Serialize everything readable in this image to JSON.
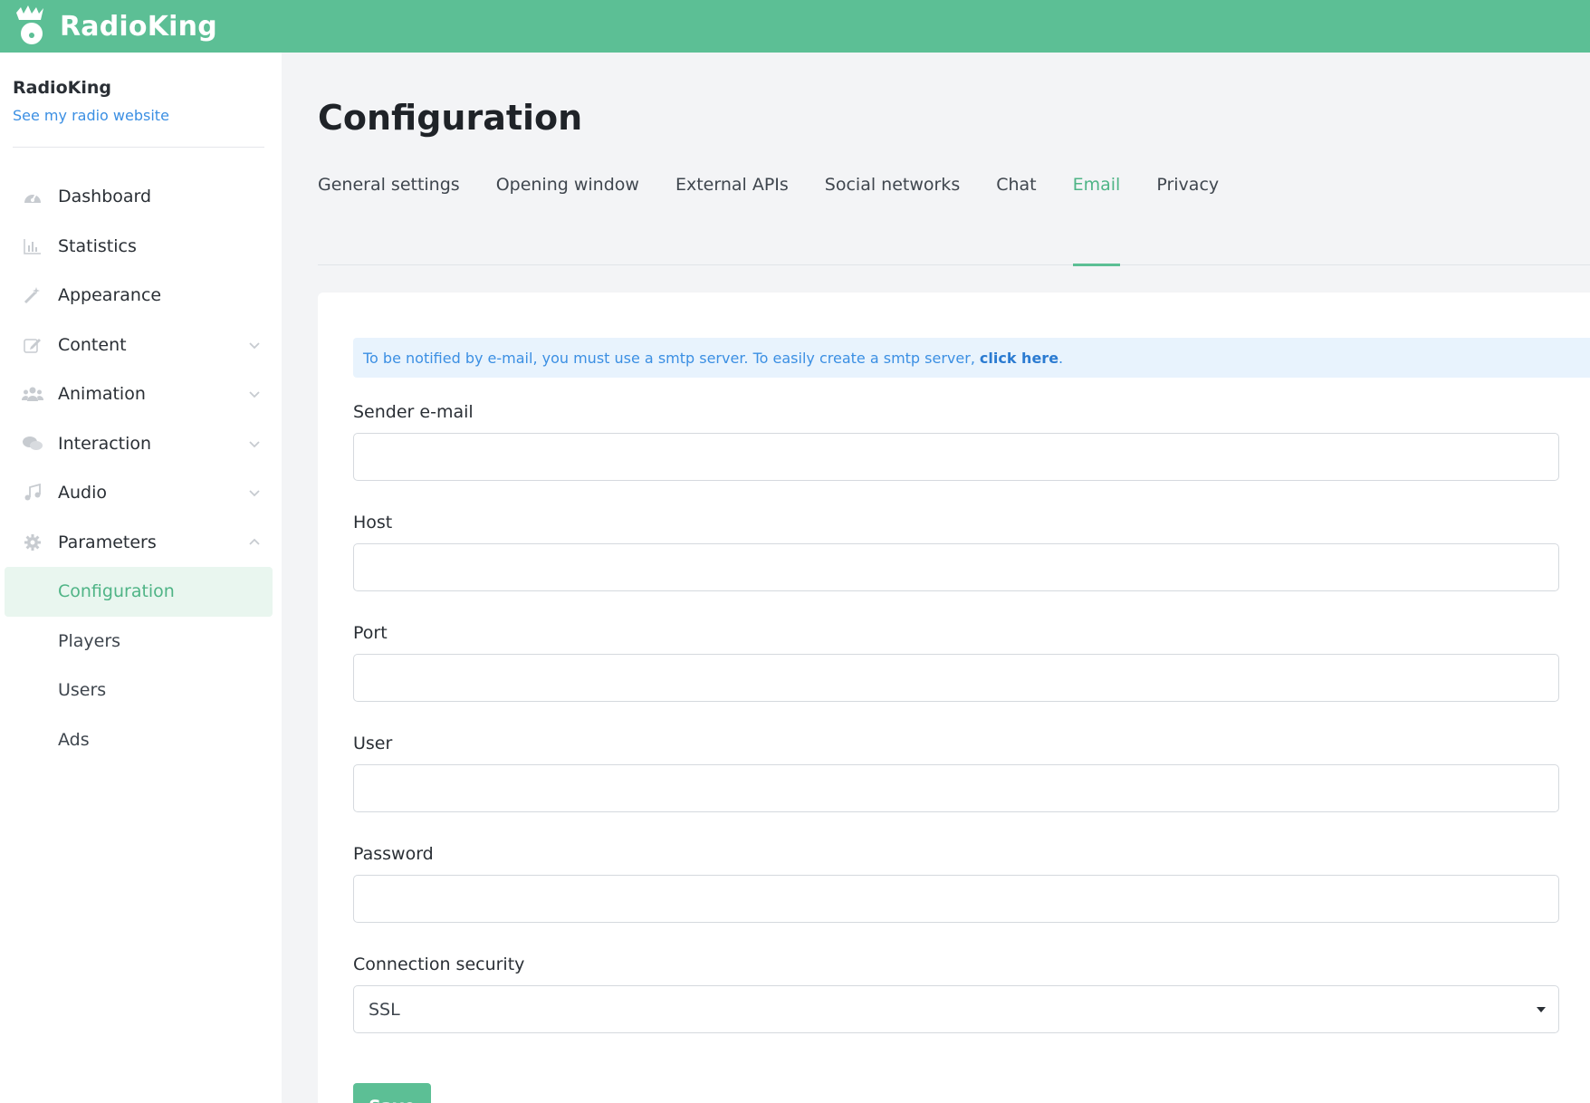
{
  "header": {
    "brand": "RadioKing"
  },
  "sidebar": {
    "radio_name": "RadioKing",
    "website_link": "See my radio website",
    "items": [
      {
        "label": "Dashboard",
        "icon": "dashboard-icon"
      },
      {
        "label": "Statistics",
        "icon": "chart-icon"
      },
      {
        "label": "Appearance",
        "icon": "magic-wand-icon"
      },
      {
        "label": "Content",
        "icon": "edit-icon"
      },
      {
        "label": "Animation",
        "icon": "people-icon"
      },
      {
        "label": "Interaction",
        "icon": "chat-icon"
      },
      {
        "label": "Audio",
        "icon": "music-icon"
      },
      {
        "label": "Parameters",
        "icon": "gear-icon"
      }
    ],
    "subitems": [
      {
        "label": "Configuration"
      },
      {
        "label": "Players"
      },
      {
        "label": "Users"
      },
      {
        "label": "Ads"
      }
    ]
  },
  "main": {
    "title": "Configuration",
    "tabs": [
      {
        "label": "General settings"
      },
      {
        "label": "Opening window"
      },
      {
        "label": "External APIs"
      },
      {
        "label": "Social networks"
      },
      {
        "label": "Chat"
      },
      {
        "label": "Email"
      },
      {
        "label": "Privacy"
      }
    ],
    "notice": {
      "text": "To be notified by e-mail, you must use a smtp server. To easily create a smtp server,",
      "link": "click here",
      "end": "."
    },
    "form": {
      "sender_label": "Sender e-mail",
      "sender_value": "",
      "host_label": "Host",
      "host_value": "",
      "port_label": "Port",
      "port_value": "",
      "user_label": "User",
      "user_value": "",
      "password_label": "Password",
      "password_value": "",
      "security_label": "Connection security",
      "security_value": "SSL",
      "save_label": "Save"
    }
  },
  "colors": {
    "accent": "#5cbf95",
    "link": "#3b8fe3",
    "notice_bg": "#e8f3fd"
  }
}
